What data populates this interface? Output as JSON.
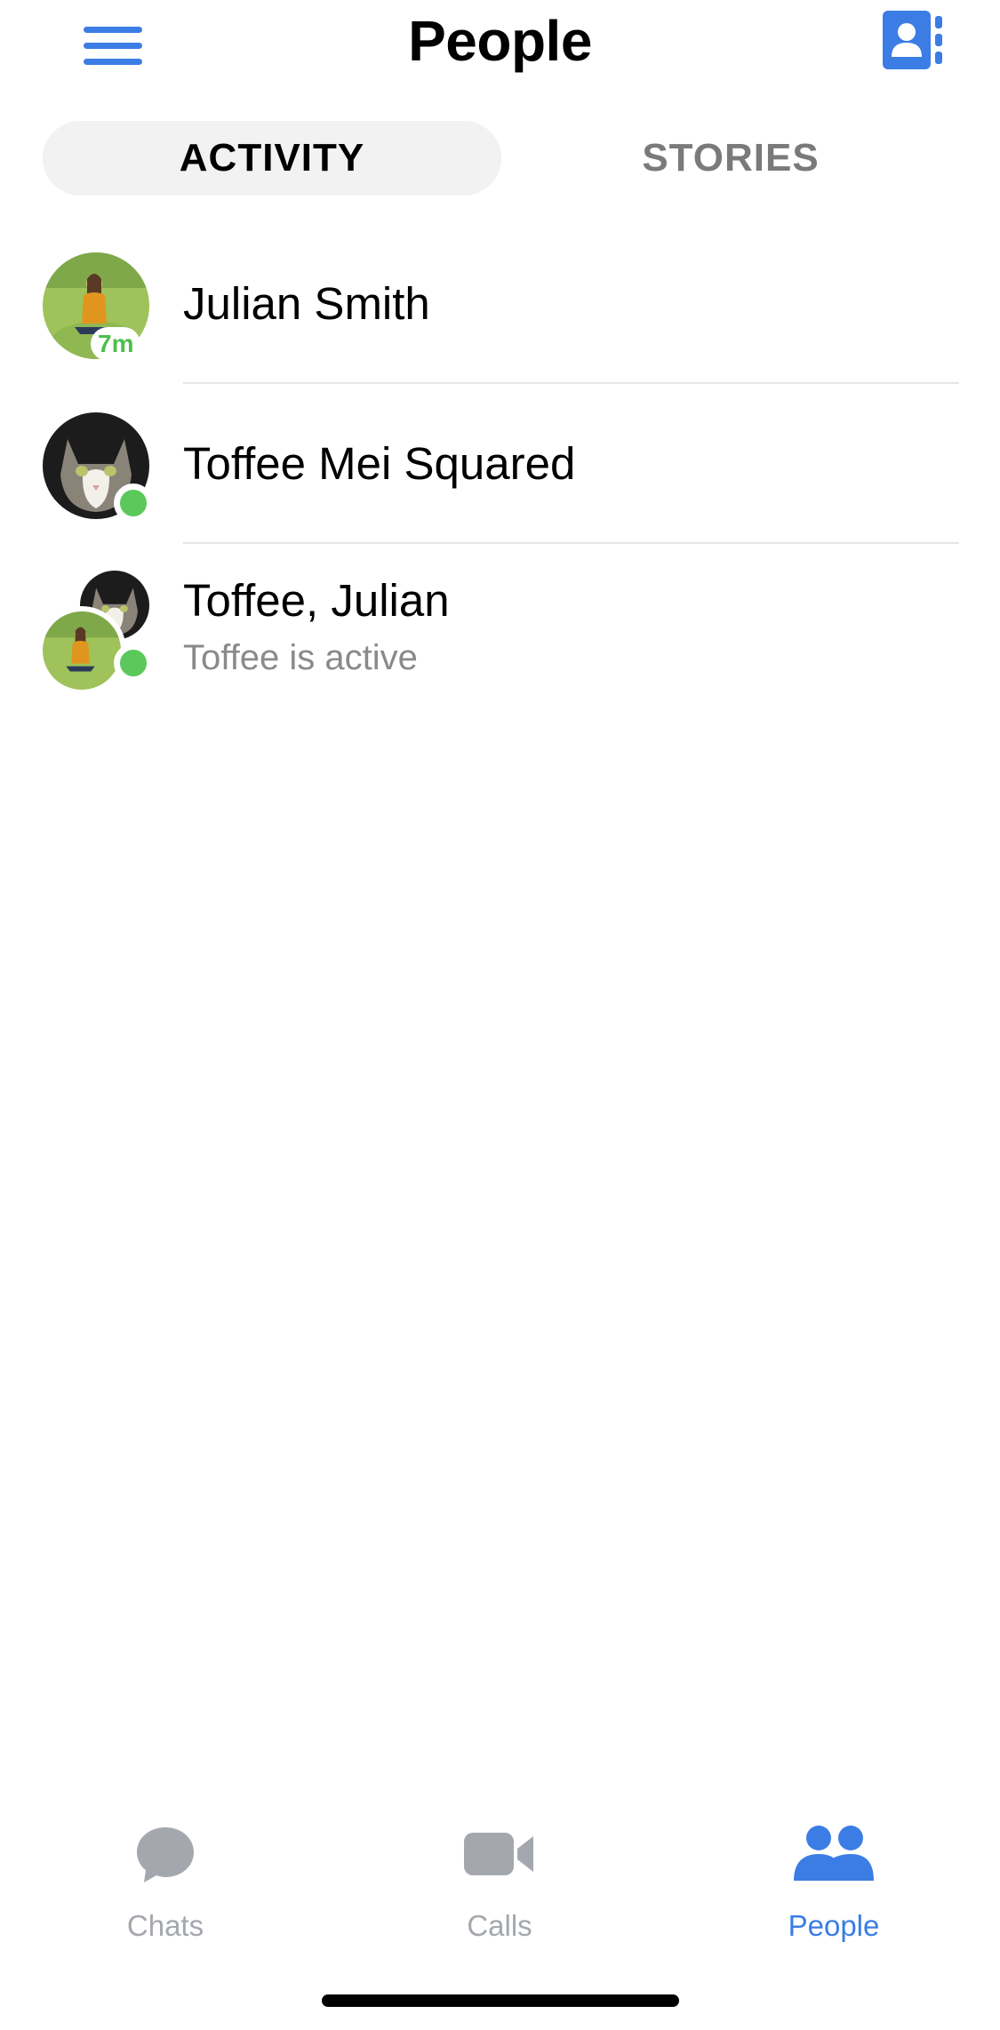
{
  "header": {
    "title": "People",
    "menu_icon": "hamburger-menu-icon",
    "contacts_icon": "contacts-book-icon",
    "accent": "#3b7de4"
  },
  "segments": {
    "activity": "ACTIVITY",
    "stories": "STORIES",
    "selected": "ACTIVITY"
  },
  "people": [
    {
      "name": "Julian Smith",
      "status_badge": "7m",
      "avatar": "woman-on-grass-photo"
    },
    {
      "name": "Toffee Mei Squared",
      "status": "online",
      "avatar": "cat-photo"
    },
    {
      "name": "Toffee, Julian",
      "subtitle": "Toffee is active",
      "status": "online",
      "avatar": "group-cat-and-woman-photo"
    }
  ],
  "tabbar": {
    "chats": "Chats",
    "calls": "Calls",
    "people": "People",
    "active": "People",
    "inactive_color": "#a4a8ae",
    "active_color": "#3b7de4"
  },
  "status_color": "#5ac85a"
}
